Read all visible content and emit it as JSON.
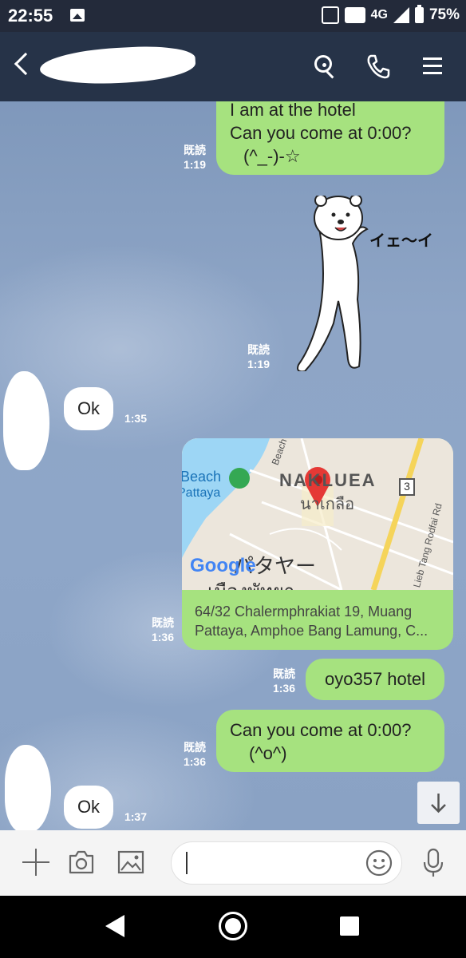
{
  "status_bar": {
    "time": "22:55",
    "network": "4G",
    "battery_pct": "75%"
  },
  "header": {
    "back_icon": "chevron-left-icon",
    "icons": [
      "search-icon",
      "phone-icon",
      "menu-icon"
    ]
  },
  "messages": [
    {
      "type": "text",
      "direction": "out",
      "lines": [
        "I am at the hotel",
        "Can you come at 0:00?",
        "(^_-)-☆"
      ],
      "read": "既読",
      "time": "1:19"
    },
    {
      "type": "sticker",
      "direction": "out",
      "sticker_text": "イェ～イ",
      "read": "既読",
      "time": "1:19"
    },
    {
      "type": "text",
      "direction": "in",
      "text": "Ok",
      "time": "1:35"
    },
    {
      "type": "location",
      "direction": "out",
      "map_labels": {
        "beach": "Beach",
        "pattaya": "Pattaya",
        "naklua": "NAKLUEA",
        "naklua_th": "นาเกลือ",
        "road": "Beach",
        "route": "3",
        "side_road": "Lieb Tang Rodfai Rd",
        "pattaya_kana": "パタヤー",
        "pattaya_th": "เมืองพัทยา",
        "google": "Google"
      },
      "address_lines": [
        "64/32 Chalermphrakiat 19, Muang",
        "Pattaya, Amphoe Bang Lamung, C..."
      ],
      "read": "既読",
      "time": "1:36"
    },
    {
      "type": "text",
      "direction": "out",
      "text": "oyo357 hotel",
      "read": "既読",
      "time": "1:36"
    },
    {
      "type": "text",
      "direction": "out",
      "lines": [
        "Can you come at 0:00?",
        "(^o^)"
      ],
      "read": "既読",
      "time": "1:36"
    },
    {
      "type": "text",
      "direction": "in",
      "text": "Ok",
      "time": "1:37"
    }
  ],
  "input_bar": {
    "icons": [
      "plus-icon",
      "camera-icon",
      "image-icon",
      "emoji-icon",
      "mic-icon"
    ],
    "value": ""
  },
  "colors": {
    "outgoing_bubble": "#a6e27f",
    "incoming_bubble": "#ffffff",
    "header": "#263348",
    "chat_background": "#8ea6c8"
  }
}
